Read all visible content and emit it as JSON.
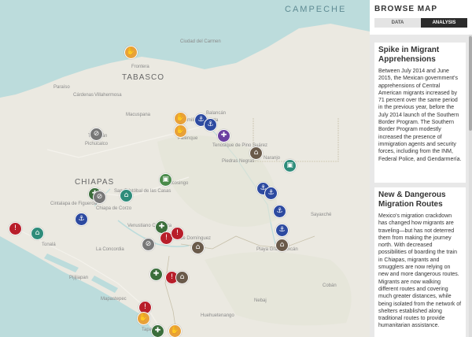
{
  "sidebar": {
    "title": "BROWSE MAP",
    "tabs": [
      {
        "label": "DATA",
        "active": false
      },
      {
        "label": "ANALYSIS",
        "active": true
      }
    ],
    "cards": [
      {
        "heading": "Spike in Migrant Apprehensions",
        "body": "Between July 2014 and June 2015, the Mexican government's apprehensions of Central American migrants increased by 71 percent over the same period in the previous year, before the July 2014 launch of the Southern Border Program. The Southern Border Program modestly increased the presence of immigration agents and security forces, including from the INM, Federal Police, and Gendarmería."
      },
      {
        "heading": "New & Dangerous Migration Routes",
        "body": "Mexico's migration crackdown has changed how migrants are traveling—but has not deterred them from making the journey north. With decreased possibilities of boarding the train in Chiapas, migrants and smugglers are now relying on new and more dangerous routes. Migrants are now walking different routes and covering much greater distances, while being isolated from the network of shelters established along traditional routes to provide humanitarian assistance."
      }
    ]
  },
  "map": {
    "labels": {
      "campeche": "CAMPECHE",
      "tabasco": "TABASCO",
      "chiapas": "CHIAPAS",
      "ciudad_del_carmen": "Ciudad del Carmen",
      "frontera": "Frontera",
      "paraiso": "Paraíso",
      "cardenas": "Cárdenas",
      "villahermosa": "Villahermosa",
      "macuspana": "Macuspana",
      "balancan": "Balancán",
      "emiliano_zapata": "Emiliano Zapata",
      "tenosique": "Tenosique de Pino Suárez",
      "palenque": "Palenque",
      "tecpatan": "Tecpatán",
      "pichucalco": "Pichucalco",
      "piedras_negras": "Piedras Negras",
      "naranjo": "Naranjo",
      "san_cristobal": "San Cristóbal de las Casas",
      "chiapa_de_corzo": "Chiapa de Corzo",
      "cintalapa": "Cintalapa de Figueroa",
      "ocosingo": "Ocosingo",
      "tonala": "Tonalá",
      "comitan": "Comitán de Domínguez",
      "venustiano": "Venustiano Carranza",
      "la_concordia": "La Concordia",
      "sayaxche": "Sayaxché",
      "playa_grande": "Playa Grande Ixcán",
      "cobán": "Cobán",
      "pijijiapan": "Pijijiapan",
      "mapastepec": "Mapastepec",
      "huehuetenango": "Huehuetenango",
      "nebaj": "Nebaj",
      "tapachula": "Tapachula"
    }
  }
}
